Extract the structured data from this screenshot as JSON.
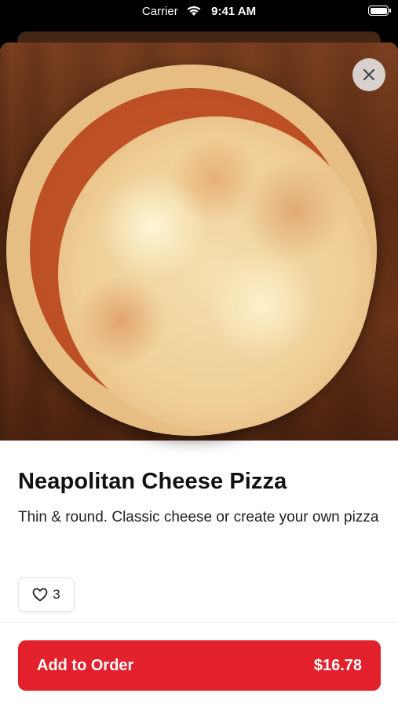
{
  "status_bar": {
    "carrier": "Carrier",
    "time": "9:41 AM"
  },
  "product": {
    "title": "Neapolitan Cheese Pizza",
    "description": "Thin & round. Classic cheese or create your own pizza",
    "likes": "3"
  },
  "order": {
    "add_label": "Add to Order",
    "price": "$16.78"
  },
  "colors": {
    "accent": "#e3212d"
  }
}
